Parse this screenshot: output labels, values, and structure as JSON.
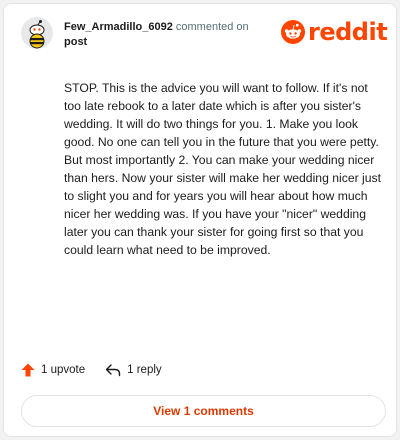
{
  "header": {
    "username": "Few_Armadillo_6092",
    "action_text": "commented on",
    "post_link": "post",
    "brand": "reddit"
  },
  "comment": {
    "body": "STOP. This is the advice you will want to follow. If it's not too late rebook to a later date which is after you sister's wedding. It will do two things for you. 1. Make you look good. No one can tell you in the future that you were petty. But most importantly 2. You can make your wedding nicer than hers. Now your sister will make her wedding nicer just to slight you and for years you will hear about how much nicer her wedding was. If you have your \"nicer\" wedding later you can thank your sister for going first so that you could learn what need to be improved."
  },
  "actions": {
    "upvote_label": "1 upvote",
    "reply_label": "1 reply",
    "view_comments_label": "View 1 comments"
  },
  "colors": {
    "brand": "#ff4500",
    "link": "#d93a00",
    "text": "#1c1c1c",
    "muted": "#576f76"
  },
  "icons": {
    "avatar": "snoo-avatar",
    "logo": "reddit-snoo-icon",
    "upvote": "upvote-arrow-icon",
    "reply": "reply-arrow-icon"
  }
}
